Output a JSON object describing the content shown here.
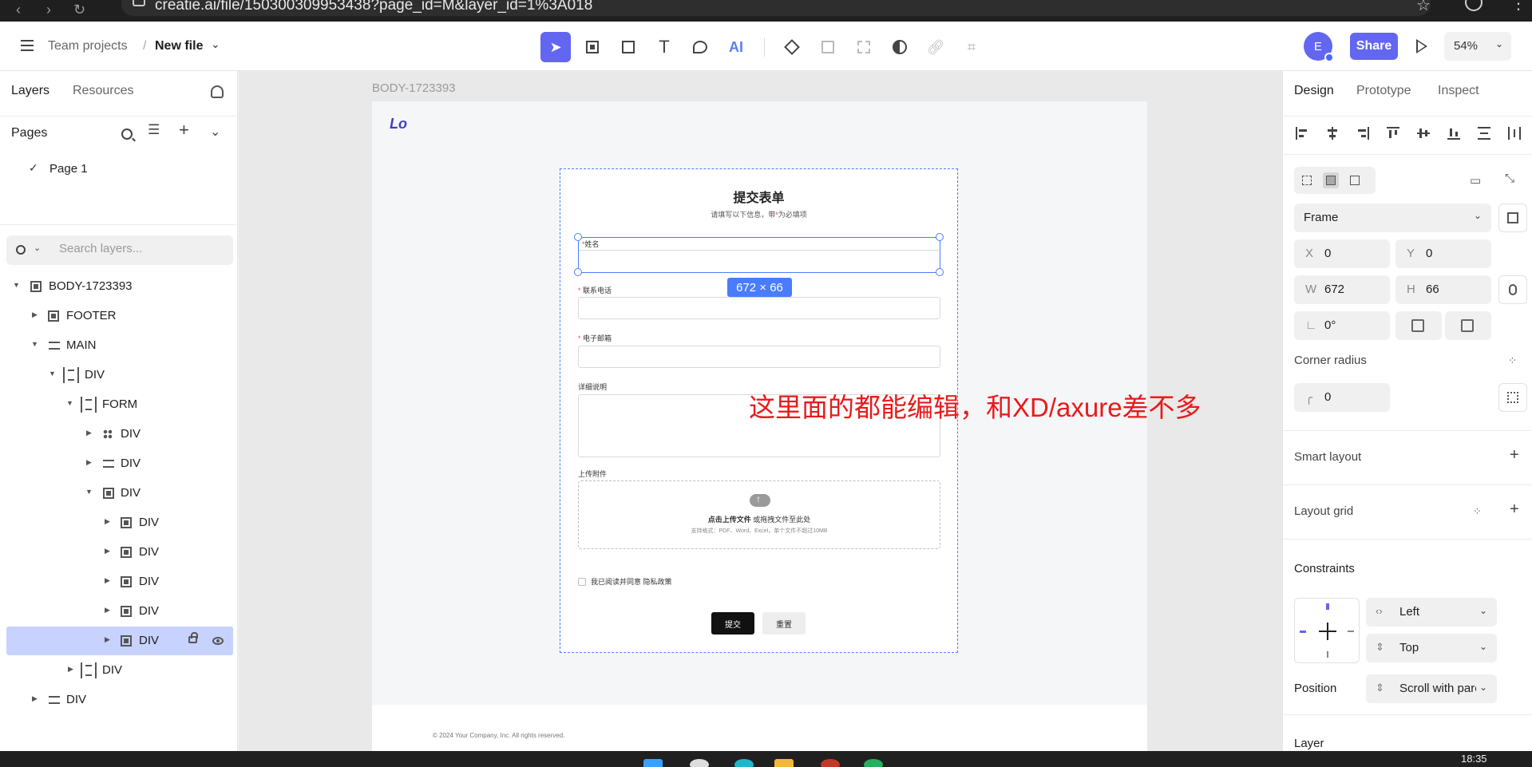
{
  "browser": {
    "url": "creatie.ai/file/150300309953438?page_id=M&layer_id=1%3A018"
  },
  "header": {
    "project": "Team projects",
    "separator": "/",
    "file_name": "New file",
    "avatar_initial": "E",
    "share_label": "Share",
    "zoom": "54%",
    "ai_tool_label": "AI"
  },
  "left_panel": {
    "tabs": [
      "Layers",
      "Resources"
    ],
    "pages_label": "Pages",
    "pages": [
      "Page 1"
    ],
    "search_placeholder": "Search layers...",
    "layers": [
      {
        "name": "BODY-1723393",
        "icon": "frame-icon"
      },
      {
        "name": "FOOTER",
        "icon": "frame-icon"
      },
      {
        "name": "MAIN",
        "icon": "stack-icon"
      },
      {
        "name": "DIV",
        "icon": "flex-layout-icon"
      },
      {
        "name": "FORM",
        "icon": "flex-frame-icon"
      },
      {
        "name": "DIV",
        "icon": "grid-icon"
      },
      {
        "name": "DIV",
        "icon": "stack-icon"
      },
      {
        "name": "DIV",
        "icon": "frame-icon"
      },
      {
        "name": "DIV",
        "icon": "frame-icon"
      },
      {
        "name": "DIV",
        "icon": "frame-icon"
      },
      {
        "name": "DIV",
        "icon": "frame-icon"
      },
      {
        "name": "DIV",
        "icon": "frame-icon"
      },
      {
        "name": "DIV",
        "icon": "frame-icon"
      },
      {
        "name": "DIV",
        "icon": "flex-frame-icon"
      },
      {
        "name": "DIV",
        "icon": "stack-icon"
      }
    ]
  },
  "canvas": {
    "frame_label": "BODY-1723393",
    "logo_text": "Lo",
    "form": {
      "title": "提交表单",
      "subtitle_before": "请填写以下信息，带",
      "subtitle_star": "*",
      "subtitle_after": "为必填项",
      "name_label": "姓名",
      "required_star": "*",
      "phone_label": "联系电话",
      "email_label": "电子邮箱",
      "detail_label": "详细说明",
      "upload_label": "上传附件",
      "upload_main_bold": "点击上传文件",
      "upload_main_rest": " 或拖拽文件至此处",
      "upload_hint": "支持格式：PDF、Word、Excel，单个文件不超过10MB",
      "agree_text": "我已阅读并同意 隐私政策",
      "submit_label": "提交",
      "reset_label": "重置"
    },
    "selection_size": "672 × 66",
    "annotation": "这里面的都能编辑，和XD/axure差不多",
    "footer_text": "© 2024 Your Company, Inc. All rights reserved."
  },
  "right_panel": {
    "tabs": [
      "Design",
      "Prototype",
      "Inspect"
    ],
    "frame_type": "Frame",
    "x": {
      "key": "X",
      "value": "0"
    },
    "y": {
      "key": "Y",
      "value": "0"
    },
    "w": {
      "key": "W",
      "value": "672"
    },
    "h": {
      "key": "H",
      "value": "66"
    },
    "rotation": "0°",
    "corner_radius_label": "Corner radius",
    "corner_radius_value": "0",
    "smart_layout_label": "Smart layout",
    "layout_grid_label": "Layout grid",
    "constraints_label": "Constraints",
    "constraint_h": "Left",
    "constraint_v": "Top",
    "position_label": "Position",
    "position_value": "Scroll with parent",
    "layer_label": "Layer"
  },
  "taskbar": {
    "clock": "18:35"
  },
  "colors": {
    "accent": "#6366f1",
    "selection": "#4a7cff",
    "annotation": "#e81b1b"
  }
}
